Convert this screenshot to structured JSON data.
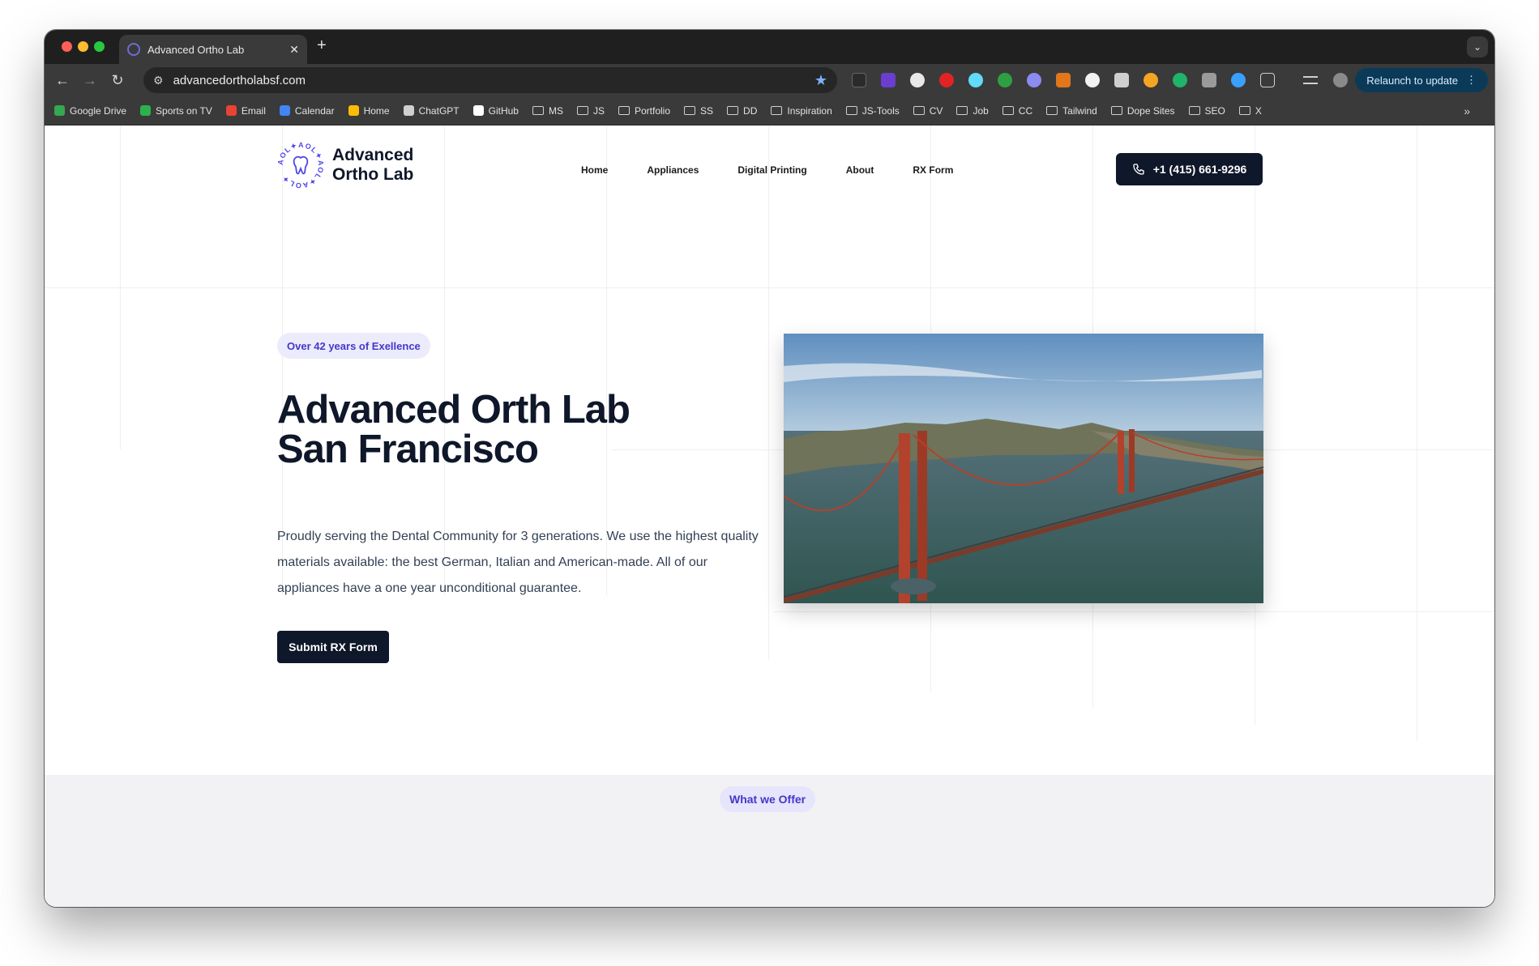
{
  "browser": {
    "tab_title": "Advanced Ortho Lab",
    "tab_close": "✕",
    "new_tab": "+",
    "url": "advancedortholabsf.com",
    "relaunch_label": "Relaunch to update",
    "bookmarks": [
      {
        "label": "Google Drive",
        "icon": "google-drive-icon",
        "color": "#34a853"
      },
      {
        "label": "Sports on TV",
        "icon": "sports-icon",
        "color": "#2bb24c"
      },
      {
        "label": "Email",
        "icon": "gmail-icon",
        "color": "#ea4335"
      },
      {
        "label": "Calendar",
        "icon": "calendar-icon",
        "color": "#4285f4"
      },
      {
        "label": "Home",
        "icon": "maps-icon",
        "color": "#fbbc04"
      },
      {
        "label": "ChatGPT",
        "icon": "chatgpt-icon",
        "color": "#d0d0d0"
      },
      {
        "label": "GitHub",
        "icon": "github-icon",
        "color": "#ffffff"
      },
      {
        "label": "MS",
        "icon": "folder-icon"
      },
      {
        "label": "JS",
        "icon": "folder-icon"
      },
      {
        "label": "Portfolio",
        "icon": "folder-icon"
      },
      {
        "label": "SS",
        "icon": "folder-icon"
      },
      {
        "label": "DD",
        "icon": "folder-icon"
      },
      {
        "label": "Inspiration",
        "icon": "folder-icon"
      },
      {
        "label": "JS-Tools",
        "icon": "folder-icon"
      },
      {
        "label": "CV",
        "icon": "folder-icon"
      },
      {
        "label": "Job",
        "icon": "folder-icon"
      },
      {
        "label": "CC",
        "icon": "folder-icon"
      },
      {
        "label": "Tailwind",
        "icon": "folder-icon"
      },
      {
        "label": "Dope Sites",
        "icon": "folder-icon"
      },
      {
        "label": "SEO",
        "icon": "folder-icon"
      },
      {
        "label": "X",
        "icon": "folder-icon"
      }
    ],
    "bookmarks_more": "»"
  },
  "site": {
    "logo_text": "Advanced Ortho Lab",
    "logo_ring_text": "AOL✦AOL✦AOL✦AOL✦",
    "nav": [
      "Home",
      "Appliances",
      "Digital Printing",
      "About",
      "RX Form"
    ],
    "phone": "+1 (415) 661-9296",
    "badge": "Over 42 years of Exellence",
    "hero_title_line1": "Advanced Orth Lab",
    "hero_title_line2": "San Francisco",
    "hero_text": "Proudly serving the Dental Community for 3 generations. We use the highest quality materials available: the best German, Italian and American-made. All of our appliances have a one year unconditional guarantee.",
    "cta": "Submit RX Form",
    "offer_badge": "What we Offer"
  },
  "colors": {
    "brand_dark": "#0f172a",
    "accent": "#4338ca",
    "badge_bg": "#ecebfc"
  }
}
